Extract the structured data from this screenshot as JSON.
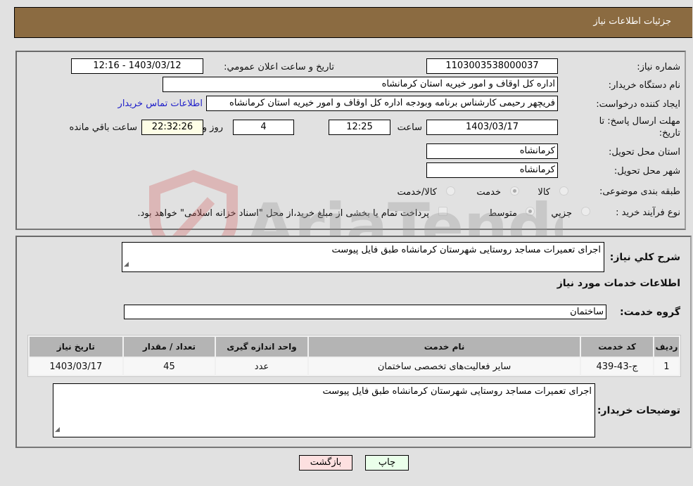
{
  "header": {
    "title": "جزئیات اطلاعات نیاز"
  },
  "details": {
    "need_number_label": "شماره نیاز:",
    "need_number": "1103003538000037",
    "announce_label": "تاریخ و ساعت اعلان عمومي:",
    "announce_value": "1403/03/12 - 12:16",
    "buyer_org_label": "نام دستگاه خريدار:",
    "buyer_org": "اداره کل اوقاف و امور خیریه استان کرمانشاه",
    "creator_label": "ايجاد کننده درخواست:",
    "creator": "فریچهر رحیمی کارشناس برنامه وبودجه اداره کل اوقاف و امور خیریه استان کرمانشاه",
    "contact_link": "اطلاعات تماس خريدار",
    "deadline_label_line1": "مهلت ارسال پاسخ: تا",
    "deadline_label_line2": "تاريخ:",
    "deadline_date": "1403/03/17",
    "time_label": "ساعت",
    "deadline_time": "12:25",
    "days_value": "4",
    "days_label": "روز و",
    "remaining_time": "22:32:26",
    "remaining_label": "ساعت باقي مانده",
    "province_label": "استان محل تحويل:",
    "province": "کرمانشاه",
    "city_label": "شهر محل تحويل:",
    "city": "کرمانشاه",
    "category_label": "طبقه بندی موضوعی:",
    "category_options": [
      {
        "label": "کالا",
        "selected": false
      },
      {
        "label": "خدمت",
        "selected": true
      },
      {
        "label": "کالا/خدمت",
        "selected": false
      }
    ],
    "purchase_type_label": "نوع فرآيند خريد :",
    "purchase_type_options": [
      {
        "label": "جزيي",
        "selected": false
      },
      {
        "label": "متوسط",
        "selected": true
      }
    ],
    "treasury_checkbox_checked": false,
    "treasury_note": "پرداخت تمام يا بخشی از مبلغ خريد،از محل \"اسناد خزانه اسلامی\" خواهد بود."
  },
  "summary": {
    "general_desc_label": "شرح کلي نياز:",
    "general_desc": "اجرای تعمیرات مساجد روستایی شهرستان کرمانشاه طبق فایل پیوست",
    "services_heading": "اطلاعات خدمات مورد نياز",
    "service_group_label": "گروه خدمت:",
    "service_group": "ساختمان"
  },
  "services_table": {
    "columns": [
      "رديف",
      "کد خدمت",
      "نام خدمت",
      "واحد اندازه گيری",
      "تعداد / مقدار",
      "تاريخ نياز"
    ],
    "rows": [
      [
        "1",
        "ج-43-439",
        "سایر فعالیت‌های تخصصی ساختمان",
        "عدد",
        "45",
        "1403/03/17"
      ]
    ]
  },
  "buyer_notes": {
    "label": "توضيحات خريدار:",
    "text": "اجرای تعمیرات مساجد روستایی شهرستان کرمانشاه طبق فایل پیوست"
  },
  "buttons": {
    "print": "چاپ",
    "back": "بازگشت"
  },
  "watermark": {
    "text": "AriaTender.neT"
  }
}
